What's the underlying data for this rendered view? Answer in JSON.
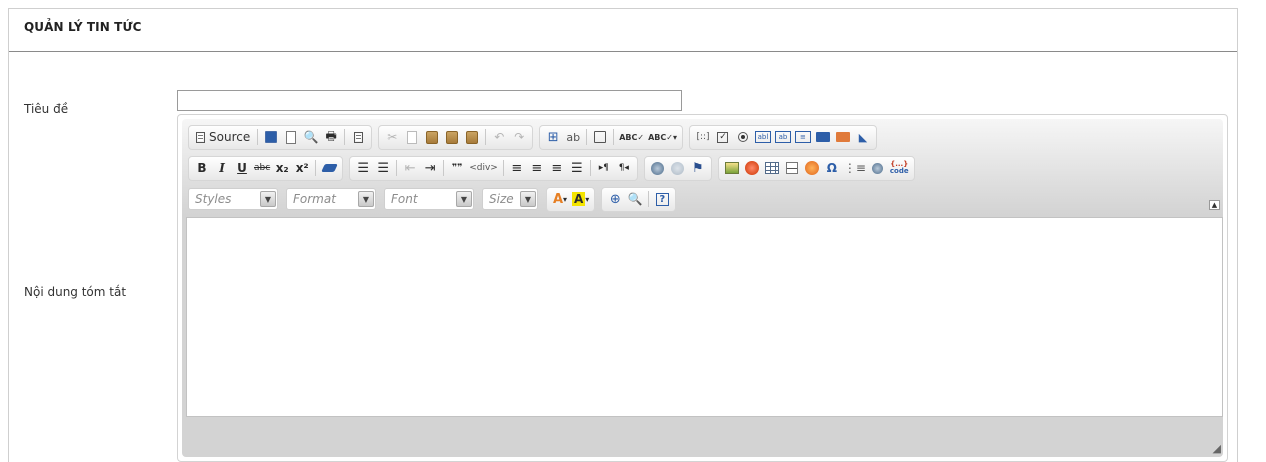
{
  "panel": {
    "title": "QUẢN LÝ TIN TỨC"
  },
  "form": {
    "title_label": "Tiêu đề",
    "title_value": "",
    "summary_label": "Nội dung tóm tắt"
  },
  "editor": {
    "toolbar": {
      "source_label": "Source",
      "bold": "B",
      "italic": "I",
      "underline": "U",
      "strike": "abc",
      "subscript": "x₂",
      "superscript": "x²",
      "blockquote": "❞❞",
      "help": "?",
      "special_char": "Ω",
      "code_snippet": "{...}",
      "code_snippet_sub": "code"
    },
    "combos": [
      {
        "name": "styles",
        "label": "Styles"
      },
      {
        "name": "format",
        "label": "Format"
      },
      {
        "name": "font",
        "label": "Font"
      },
      {
        "name": "size",
        "label": "Size"
      }
    ],
    "content": ""
  },
  "colors": {
    "toolbar_bg": "#d3d3d3",
    "text_color_icon": "#e67e22",
    "bg_color_icon": "#f4e400",
    "blue_icon": "#2d5ea8"
  }
}
